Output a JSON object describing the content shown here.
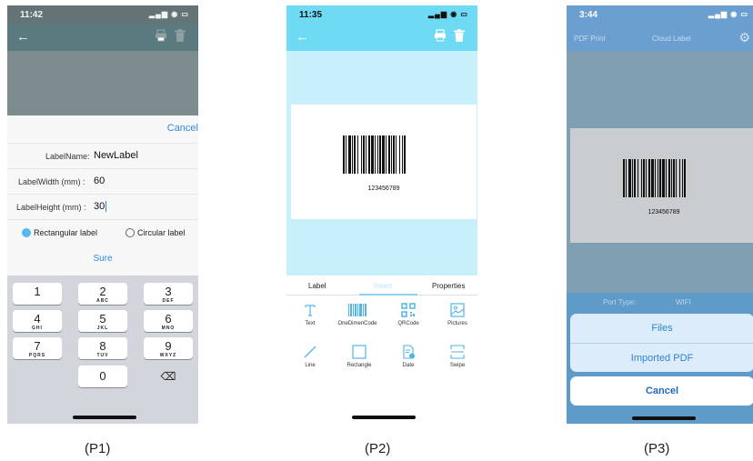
{
  "p1": {
    "time": "11:42",
    "cancel": "Cancel",
    "fields": [
      {
        "label": "LabelName:",
        "value": "NewLabel"
      },
      {
        "label": "LabelWidth (mm) :",
        "value": "60"
      },
      {
        "label": "LabelHeight (mm) :",
        "value": "30"
      }
    ],
    "radio_rect": "Rectangular label",
    "radio_circle": "Circular label",
    "selected_shape": "Rectangular label",
    "sure": "Sure",
    "keys": [
      {
        "num": "1",
        "letters": ""
      },
      {
        "num": "2",
        "letters": "ABC"
      },
      {
        "num": "3",
        "letters": "DEF"
      },
      {
        "num": "4",
        "letters": "GHI"
      },
      {
        "num": "5",
        "letters": "JKL"
      },
      {
        "num": "6",
        "letters": "MNO"
      },
      {
        "num": "7",
        "letters": "PQRS"
      },
      {
        "num": "8",
        "letters": "TUV"
      },
      {
        "num": "9",
        "letters": "WXYZ"
      },
      {
        "num": "0",
        "letters": ""
      }
    ],
    "caption": "(P1)"
  },
  "p2": {
    "time": "11:35",
    "barcode_digits": "123456789",
    "tabs": [
      "Label",
      "Insert",
      "Properties"
    ],
    "active_tab": "Insert",
    "tools": [
      {
        "label": "Text",
        "icon": "text-tool-icon"
      },
      {
        "label": "OneDimenCode",
        "icon": "barcode-tool-icon"
      },
      {
        "label": "QRCode",
        "icon": "qrcode-tool-icon"
      },
      {
        "label": "Pictures",
        "icon": "picture-tool-icon"
      },
      {
        "label": "Line",
        "icon": "line-tool-icon"
      },
      {
        "label": "Rectangle",
        "icon": "rectangle-tool-icon"
      },
      {
        "label": "Date",
        "icon": "date-tool-icon"
      },
      {
        "label": "Swipe",
        "icon": "swipe-tool-icon"
      }
    ],
    "caption": "(P2)"
  },
  "p3": {
    "time": "3:44",
    "nav_tabs": [
      "PDF Print",
      "Cloud Label"
    ],
    "barcode_digits": "123456789",
    "port_label": "Port Type:",
    "port_value": "WIFI",
    "sheet_options": [
      "Files",
      "Imported PDF"
    ],
    "cancel": "Cancel",
    "caption": "(P3)"
  },
  "colors": {
    "accent_blue": "#2f8ae0",
    "p2_header": "#6fdaf4",
    "p3_header": "#6b9fcf"
  }
}
